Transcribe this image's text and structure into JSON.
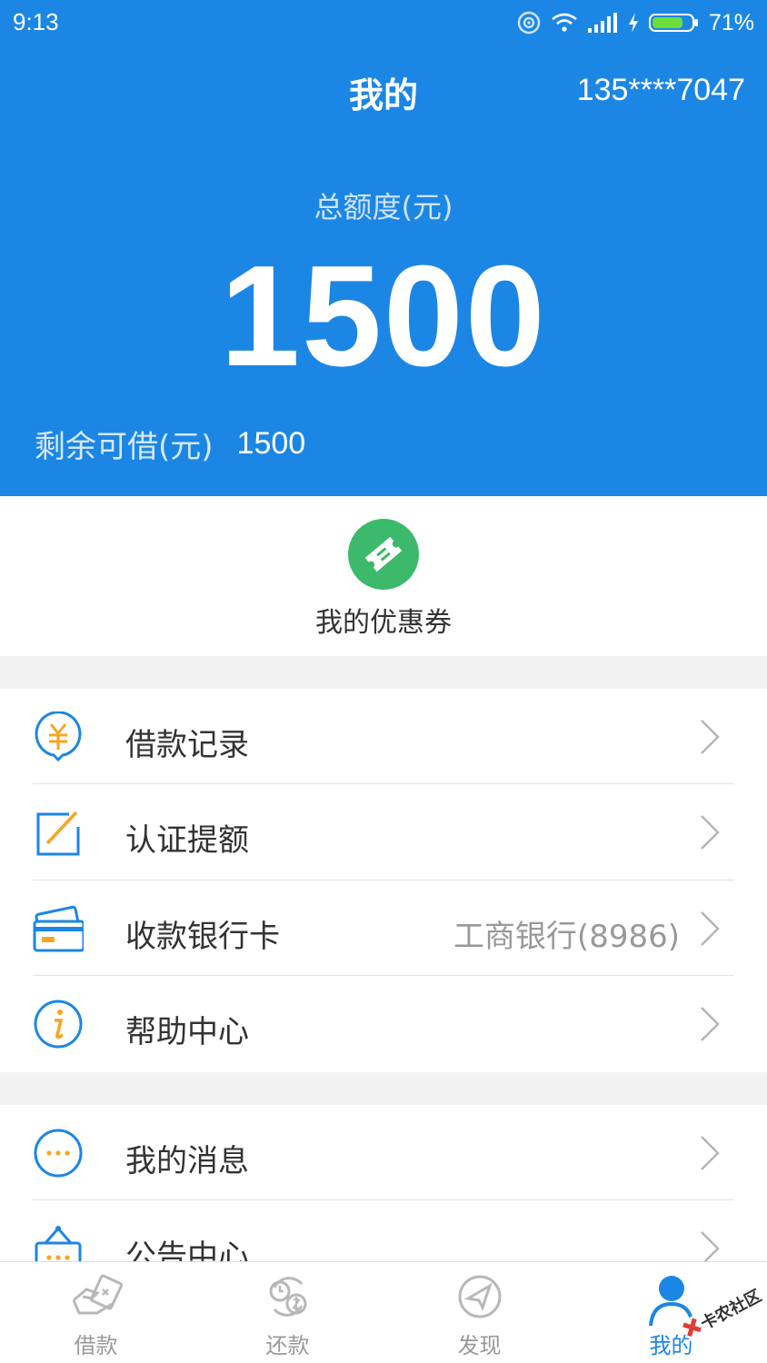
{
  "status_bar": {
    "time": "9:13",
    "battery": "71%"
  },
  "header": {
    "title": "我的",
    "phone": "135****7047",
    "total_limit_label": "总额度(元)",
    "total_limit_value": "1500",
    "remaining_label": "剩余可借(元)",
    "remaining_value": "1500"
  },
  "coupon": {
    "label": "我的优惠券",
    "icon": "ticket-icon",
    "color": "#3cb96a"
  },
  "menu_group_1": [
    {
      "label": "借款记录",
      "icon": "yuan-record-icon",
      "value": ""
    },
    {
      "label": "认证提额",
      "icon": "edit-certify-icon",
      "value": ""
    },
    {
      "label": "收款银行卡",
      "icon": "bank-card-icon",
      "value": "工商银行(8986)"
    },
    {
      "label": "帮助中心",
      "icon": "info-icon",
      "value": ""
    }
  ],
  "menu_group_2": [
    {
      "label": "我的消息",
      "icon": "message-icon",
      "value": ""
    },
    {
      "label": "公告中心",
      "icon": "notice-icon",
      "value": ""
    }
  ],
  "tabbar": [
    {
      "label": "借款",
      "icon": "loan-icon",
      "active": false
    },
    {
      "label": "还款",
      "icon": "repay-icon",
      "active": false
    },
    {
      "label": "发现",
      "icon": "discover-icon",
      "active": false
    },
    {
      "label": "我的",
      "icon": "profile-icon",
      "active": true
    }
  ],
  "watermark": {
    "text": "卡农社区"
  },
  "colors": {
    "primary": "#1c86e4",
    "accent_orange": "#f5a623",
    "coupon_green": "#3cb96a"
  }
}
